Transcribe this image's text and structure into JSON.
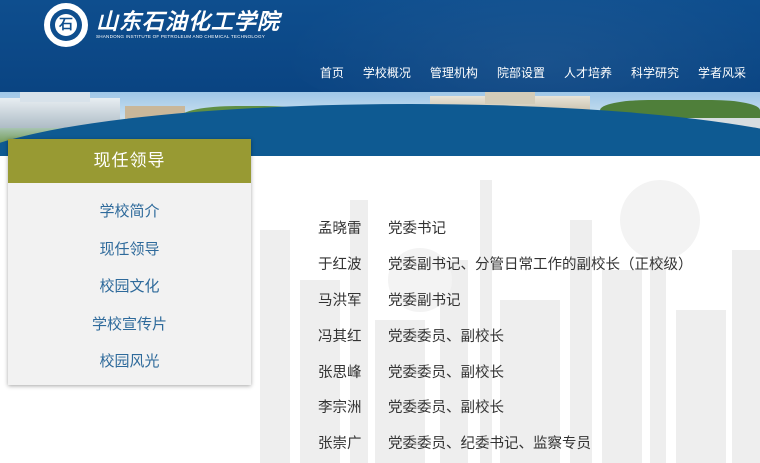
{
  "header": {
    "school_name": "山东石油化工学院",
    "school_name_en": "SHANDONG INSTITUTE OF PETROLEUM AND CHEMICAL TECHNOLOGY",
    "seal_glyph": "石",
    "colors": {
      "primary": "#0e4e8e",
      "accent": "#989a33",
      "link": "#2e6a9b"
    }
  },
  "nav": {
    "items": [
      "首页",
      "学校概况",
      "管理机构",
      "院部设置",
      "人才培养",
      "科学研究",
      "学者风采"
    ]
  },
  "sidebar": {
    "title": "现任领导",
    "items": [
      "学校简介",
      "现任领导",
      "校园文化",
      "学校宣传片",
      "校园风光"
    ]
  },
  "leaders": [
    {
      "name": "孟晓雷",
      "title": "党委书记"
    },
    {
      "name": "于红波",
      "title": "党委副书记、分管日常工作的副校长（正校级）"
    },
    {
      "name": "马洪军",
      "title": "党委副书记"
    },
    {
      "name": "冯其红",
      "title": "党委委员、副校长"
    },
    {
      "name": "张思峰",
      "title": "党委委员、副校长"
    },
    {
      "name": "李宗洲",
      "title": "党委委员、副校长"
    },
    {
      "name": "张崇广",
      "title": "党委委员、纪委书记、监察专员"
    }
  ]
}
